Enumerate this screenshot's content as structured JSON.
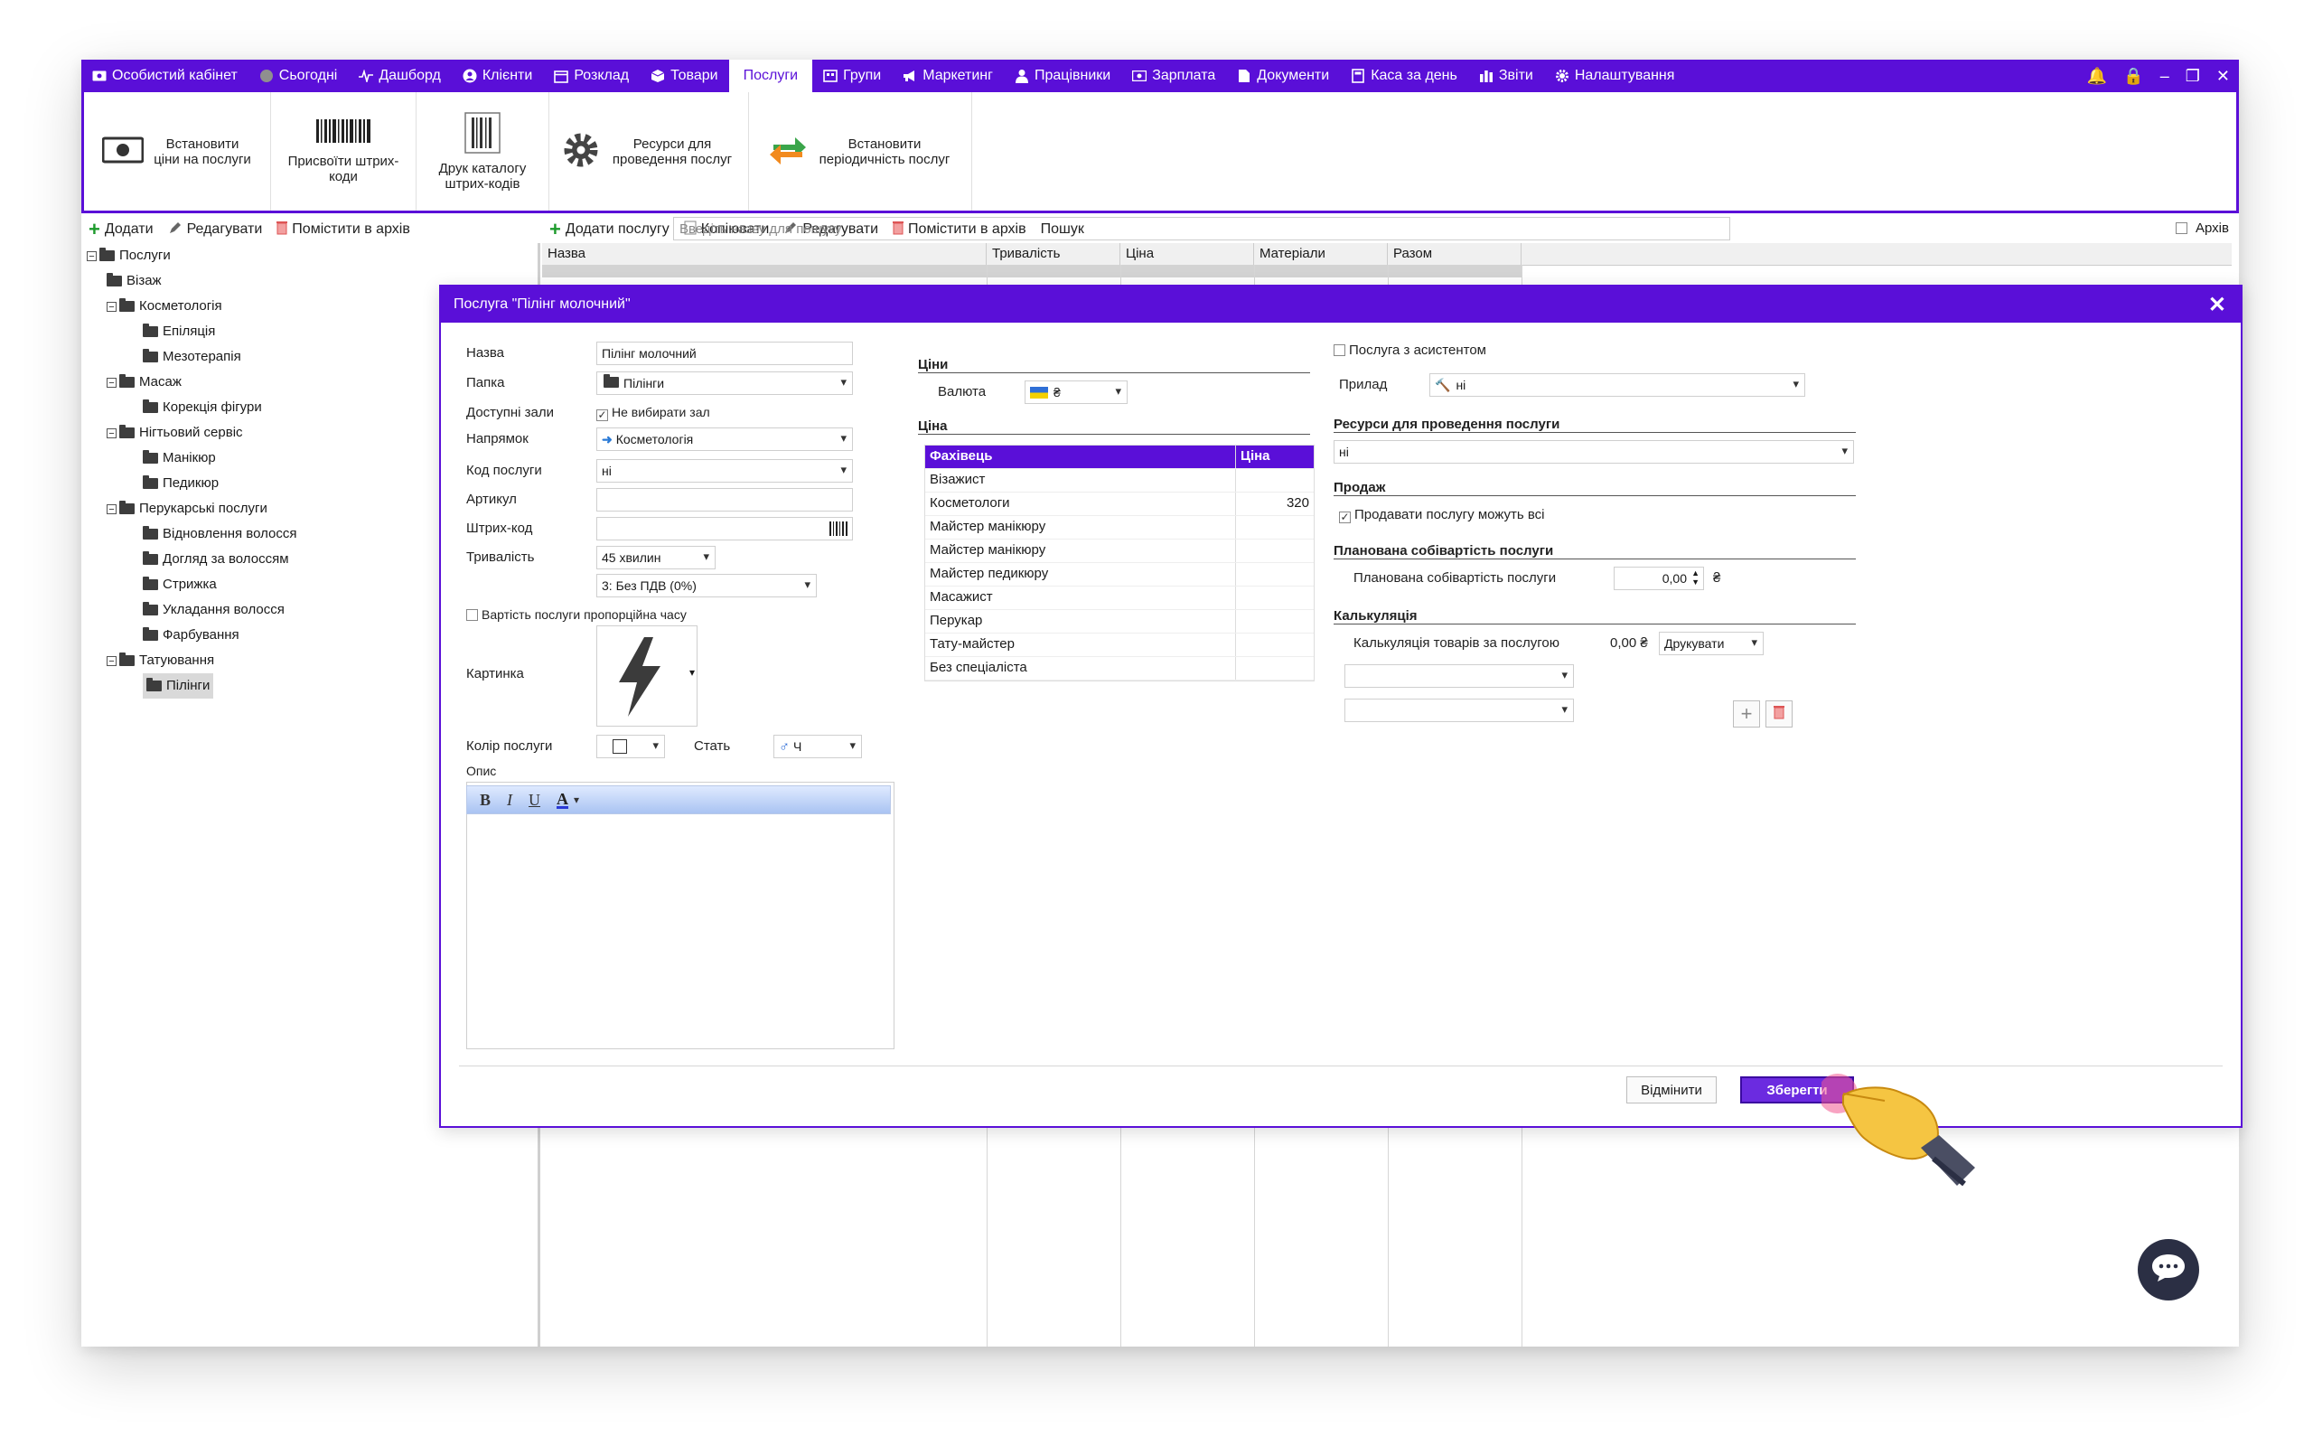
{
  "menu": {
    "items": [
      {
        "label": "Особистий кабінет",
        "icon": "cash-icon"
      },
      {
        "label": "Сьогодні",
        "icon": "clock-icon"
      },
      {
        "label": "Дашборд",
        "icon": "pulse-icon"
      },
      {
        "label": "Клієнти",
        "icon": "user-circle-icon"
      },
      {
        "label": "Розклад",
        "icon": "calendar-icon"
      },
      {
        "label": "Товари",
        "icon": "box-icon"
      },
      {
        "label": "Послуги",
        "icon": "none",
        "active": true
      },
      {
        "label": "Групи",
        "icon": "groups-icon"
      },
      {
        "label": "Маркетинг",
        "icon": "megaphone-icon"
      },
      {
        "label": "Працівники",
        "icon": "person-icon"
      },
      {
        "label": "Зарплата",
        "icon": "money-icon"
      },
      {
        "label": "Документи",
        "icon": "document-icon"
      },
      {
        "label": "Каса за день",
        "icon": "calculator-icon"
      },
      {
        "label": "Звіти",
        "icon": "bar-chart-icon"
      },
      {
        "label": "Налаштування",
        "icon": "gear-icon"
      }
    ],
    "right": {
      "bell": "🔔",
      "lock": "🔒",
      "minimize": "–",
      "restore": "❐",
      "close": "✕"
    }
  },
  "ribbon": {
    "set_prices": "Встановити ціни на послуги",
    "assign_barcodes": "Присвоїти штрих-коди",
    "print_catalog": "Друк каталогу штрих-кодів",
    "resources": "Ресурси для проведення послуг",
    "periodicity": "Встановити періодичність послуг"
  },
  "left_toolbar": {
    "add": "Додати",
    "edit": "Редагувати",
    "archive": "Помістити в архів"
  },
  "right_toolbar": {
    "add": "Додати послугу",
    "copy": "Копіювати",
    "edit": "Редагувати",
    "archive": "Помістити в архів",
    "search_label": "Пошук",
    "search_placeholder": "Введіть назву для пошуку",
    "archive_checkbox": "Архів"
  },
  "tree": {
    "root": "Послуги",
    "vizazh": "Візаж",
    "cosmetology": "Косметологія",
    "epilation": "Епіляція",
    "mesotherapy": "Мезотерапія",
    "massage": "Масаж",
    "body_correction": "Корекція фігури",
    "nail": "Нігтьовий сервіс",
    "manicure": "Манікюр",
    "pedicure": "Педикюр",
    "hair": "Перукарські послуги",
    "hair_restore": "Відновлення волосся",
    "hair_care": "Догляд за волоссям",
    "haircut": "Стрижка",
    "styling": "Укладання волосся",
    "coloring": "Фарбування",
    "tattoo": "Татуювання",
    "peels": "Пілінги"
  },
  "grid": {
    "columns": [
      "Назва",
      "Тривалість",
      "Ціна",
      "Матеріали",
      "Разом"
    ]
  },
  "dialog": {
    "title": "Послуга \"Пілінг молочний\"",
    "close": "✕",
    "labels": {
      "name": "Назва",
      "folder": "Папка",
      "halls": "Доступні зали",
      "direction": "Напрямок",
      "code": "Код послуги",
      "article": "Артикул",
      "barcode": "Штрих-код",
      "duration": "Тривалість",
      "picture": "Картинка",
      "color": "Колір послуги",
      "gender": "Стать",
      "description": "Опис"
    },
    "values": {
      "name": "Пілінг молочний",
      "folder": "Пілінги",
      "halls": "Не вибирати зал",
      "direction": "Косметологія",
      "code": "ні",
      "duration": "45 хвилин",
      "vat": "3: Без ПДВ (0%)",
      "gender": "Ч",
      "proportional": "Вартість послуги пропорційна часу"
    },
    "prices": {
      "section": "Ціни",
      "currency_label": "Валюта",
      "currency": "₴",
      "price_section": "Ціна",
      "header_specialist": "Фахівець",
      "header_price": "Ціна",
      "rows": [
        {
          "name": "Візажист",
          "price": ""
        },
        {
          "name": "Косметологи",
          "price": "320"
        },
        {
          "name": "Майстер манікюру",
          "price": ""
        },
        {
          "name": "Майстер манікюру",
          "price": ""
        },
        {
          "name": "Майстер педикюру",
          "price": ""
        },
        {
          "name": "Масажист",
          "price": ""
        },
        {
          "name": "Перукар",
          "price": ""
        },
        {
          "name": "Тату-майстер",
          "price": ""
        },
        {
          "name": "Без спеціаліста",
          "price": ""
        }
      ]
    },
    "right": {
      "assistant": "Послуга з асистентом",
      "device_label": "Прилад",
      "device": "ні",
      "resources_section": "Ресурси для проведення послуги",
      "resources": "ні",
      "sale_section": "Продаж",
      "sale_all": "Продавати послугу можуть всі",
      "cost_section": "Планована собівартість послуги",
      "cost_label": "Планована собівартість послуги",
      "cost_value": "0,00",
      "cost_currency": "₴",
      "calc_section": "Калькуляція",
      "calc_label": "Калькуляція товарів за послугою",
      "calc_value": "0,00 ₴",
      "print": "Друкувати"
    },
    "buttons": {
      "cancel": "Відмінити",
      "save": "Зберегти"
    }
  }
}
